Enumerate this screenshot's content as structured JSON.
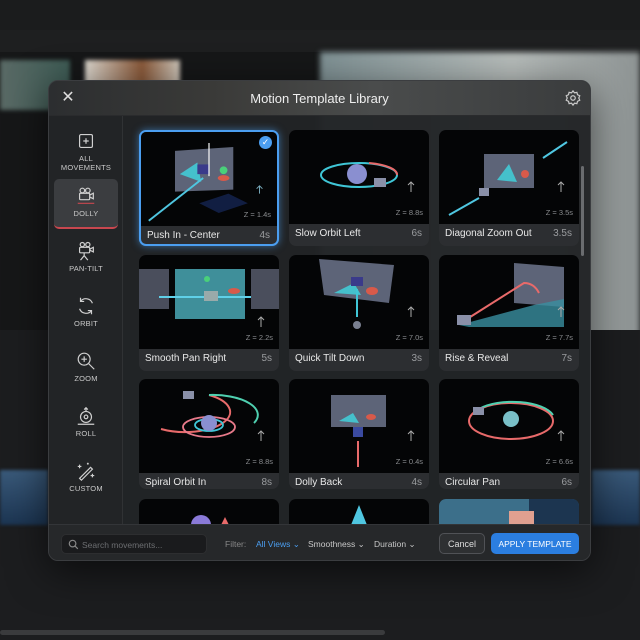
{
  "dialog": {
    "title": "Motion Template Library",
    "close_icon": "close-icon",
    "settings_icon": "gear-icon"
  },
  "sidebar": {
    "items": [
      {
        "label": "ALL MOVEMENTS",
        "icon": "plus-square-icon"
      },
      {
        "label": "DOLLY",
        "icon": "dolly-camera-icon",
        "active": true
      },
      {
        "label": "PAN-TILT",
        "icon": "tripod-camera-icon"
      },
      {
        "label": "ORBIT",
        "icon": "orbit-arrows-icon"
      },
      {
        "label": "ZOOM",
        "icon": "zoom-in-icon"
      },
      {
        "label": "ROLL",
        "icon": "roll-icon"
      },
      {
        "label": "CUSTOM",
        "icon": "magic-wand-icon"
      }
    ]
  },
  "templates": [
    {
      "name": "Push In - Center",
      "duration": "4s",
      "z": "Z = 1.4s",
      "selected": true,
      "scene": "push"
    },
    {
      "name": "Slow Orbit Left",
      "duration": "6s",
      "z": "Z = 8.8s",
      "scene": "orbit"
    },
    {
      "name": "Diagonal Zoom Out",
      "duration": "3.5s",
      "z": "Z = 3.5s",
      "scene": "diag"
    },
    {
      "name": "Smooth Pan Right",
      "duration": "5s",
      "z": "Z = 2.2s",
      "scene": "pan"
    },
    {
      "name": "Quick Tilt Down",
      "duration": "3s",
      "z": "Z = 7.0s",
      "scene": "tilt"
    },
    {
      "name": "Rise & Reveal",
      "duration": "7s",
      "z": "Z = 7.7s",
      "scene": "rise"
    },
    {
      "name": "Spiral Orbit In",
      "duration": "8s",
      "z": "Z = 8.8s",
      "scene": "spiral"
    },
    {
      "name": "Dolly Back",
      "duration": "4s",
      "z": "Z = 0.4s",
      "scene": "back"
    },
    {
      "name": "Circular Pan",
      "duration": "6s",
      "z": "Z = 6.6s",
      "scene": "circ"
    },
    {
      "name": "",
      "duration": "",
      "z": "",
      "scene": "p1"
    },
    {
      "name": "",
      "duration": "",
      "z": "",
      "scene": "p2"
    },
    {
      "name": "",
      "duration": "",
      "z": "",
      "scene": "p3"
    }
  ],
  "footer": {
    "search_placeholder": "Search movements...",
    "filter_label": "Filter:",
    "filters": [
      "All Views",
      "Smoothness",
      "Duration"
    ],
    "cancel_label": "Cancel",
    "apply_label": "APPLY TEMPLATE"
  },
  "colors": {
    "accent": "#2b7ee0",
    "selection": "#4b9ef0",
    "active_tab_underline": "#c8474f",
    "path_cyan": "#3fc6d6",
    "path_red": "#e86a6a"
  }
}
